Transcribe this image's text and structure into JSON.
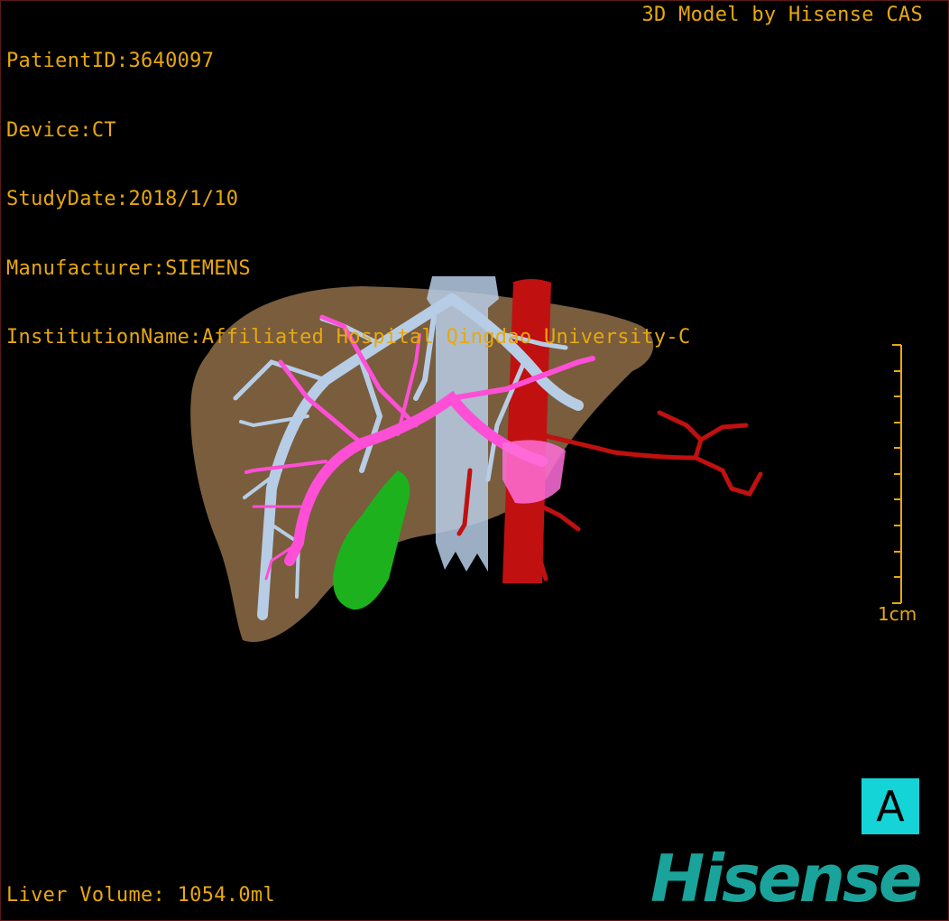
{
  "patient": {
    "patient_id": "PatientID:3640097",
    "device": "Device:CT",
    "study_date": "StudyDate:2018/1/10",
    "manufacturer": "Manufacturer:SIEMENS",
    "institution": "InstitutionName:Affiliated Hospital Qingdao University-C"
  },
  "credit": "3D Model by Hisense CAS",
  "liver_volume": "Liver Volume: 1054.0ml",
  "scale_bar": {
    "label": "1cm"
  },
  "orientation": {
    "label": "A"
  },
  "logo": {
    "text": "Hisense"
  },
  "colors": {
    "overlay_text": "#e8a80e",
    "liver": "#8a6a46",
    "hepatic_vein": "#b7cde6",
    "portal_vein": "#ff4fd6",
    "artery": "#c01010",
    "tumor": "#1db21d",
    "orientation_box": "#14d4d8",
    "logo": "#1aa39a"
  }
}
